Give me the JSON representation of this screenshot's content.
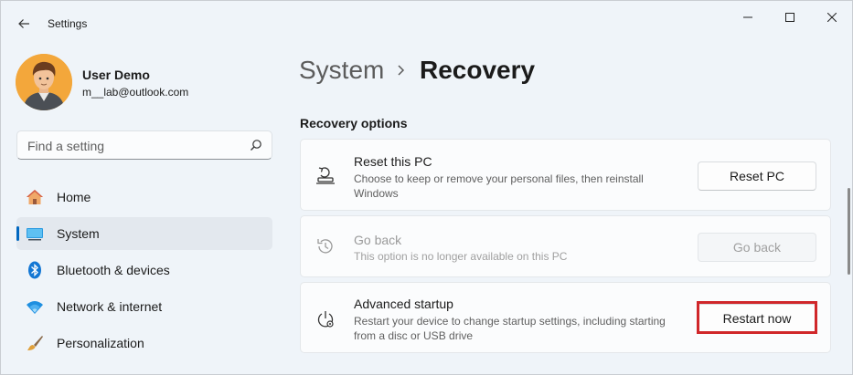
{
  "app": {
    "title": "Settings"
  },
  "profile": {
    "name": "User Demo",
    "email": "m__lab@outlook.com"
  },
  "search": {
    "placeholder": "Find a setting"
  },
  "nav": [
    {
      "label": "Home",
      "icon": "home-icon"
    },
    {
      "label": "System",
      "icon": "system-icon",
      "active": true
    },
    {
      "label": "Bluetooth & devices",
      "icon": "bluetooth-icon"
    },
    {
      "label": "Network & internet",
      "icon": "wifi-icon"
    },
    {
      "label": "Personalization",
      "icon": "brush-icon"
    }
  ],
  "breadcrumb": {
    "parent": "System",
    "current": "Recovery"
  },
  "section": {
    "title": "Recovery options"
  },
  "cards": [
    {
      "title": "Reset this PC",
      "desc": "Choose to keep or remove your personal files, then reinstall Windows",
      "button": "Reset PC",
      "icon": "reset-pc-icon",
      "enabled": true
    },
    {
      "title": "Go back",
      "desc": "This option is no longer available on this PC",
      "button": "Go back",
      "icon": "history-icon",
      "enabled": false
    },
    {
      "title": "Advanced startup",
      "desc": "Restart your device to change startup settings, including starting from a disc or USB drive",
      "button": "Restart now",
      "icon": "advanced-startup-icon",
      "enabled": true
    }
  ],
  "colors": {
    "accent": "#0067c0",
    "highlight": "#d0272a",
    "background": "#eff4f9"
  }
}
